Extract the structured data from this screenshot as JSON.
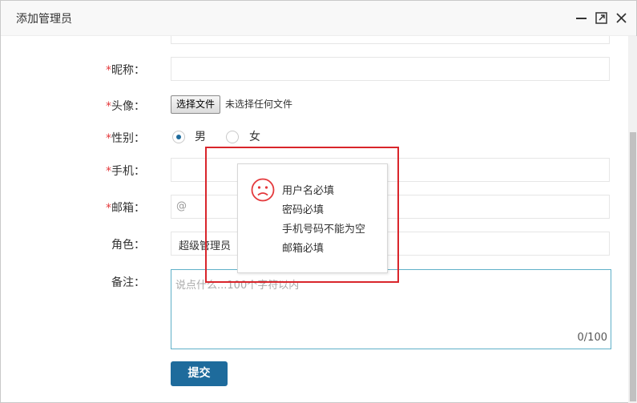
{
  "dialog": {
    "title": "添加管理员",
    "controls": [
      "minimize-icon",
      "maximize-icon",
      "close-icon"
    ]
  },
  "form": {
    "required_mark": "*",
    "nickname": {
      "label": "昵称：",
      "value": ""
    },
    "avatar": {
      "label": "头像：",
      "button": "选择文件",
      "status": "未选择任何文件"
    },
    "gender": {
      "label": "性别：",
      "options": [
        "男",
        "女"
      ],
      "selected": "男"
    },
    "phone": {
      "label": "手机：",
      "value": ""
    },
    "email": {
      "label": "邮箱：",
      "placeholder": "@"
    },
    "role": {
      "label": "角色：",
      "value": "超级管理员"
    },
    "remark": {
      "label": "备注：",
      "placeholder": "说点什么...100个字符以内",
      "counter": "0/100"
    },
    "submit": "提交"
  },
  "error_tip": {
    "icon": "sad-face-icon",
    "messages": [
      "用户名必填",
      "密码必填",
      "手机号码不能为空",
      "邮箱必填"
    ]
  },
  "colors": {
    "primary": "#1E6B9C",
    "required": "#e4393c",
    "highlight_box": "#d9252b",
    "error_icon": "#e4393c"
  }
}
